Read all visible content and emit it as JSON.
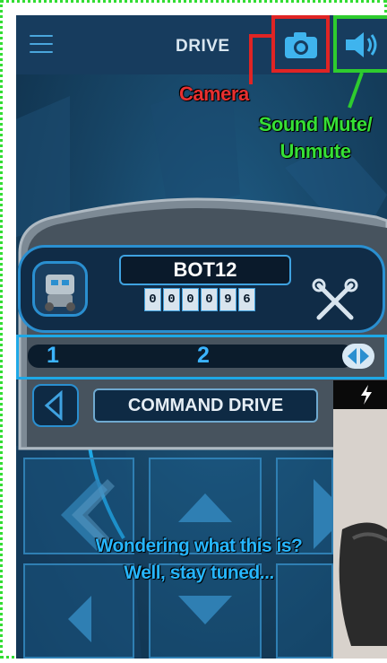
{
  "header": {
    "title": "DRIVE",
    "menu_icon": "hamburger-menu-icon",
    "camera_icon": "camera-icon",
    "sound_icon": "speaker-icon"
  },
  "annotations": {
    "camera": "Camera",
    "sound_line1": "Sound Mute/",
    "sound_line2": "Unmute",
    "wonder_line1": "Wondering what this is?",
    "wonder_line2": "Well, stay tuned..."
  },
  "robot": {
    "name": "BOT12",
    "counter_digits": [
      "0",
      "0",
      "0",
      "0",
      "9",
      "6"
    ],
    "settings_icon": "tools-icon"
  },
  "slider": {
    "left_label": "1",
    "mid_label": "2",
    "knob_icon": "left-right-arrows-icon"
  },
  "mode": {
    "label": "COMMAND DRIVE",
    "prev_icon": "chevron-left-icon"
  },
  "camera_preview": {
    "flash_icon": "flash-icon"
  },
  "colors": {
    "camera_annotation": "#e83030",
    "sound_annotation": "#36e036",
    "info_annotation": "#26b6ff",
    "frame_dotted": "#33dd33"
  }
}
